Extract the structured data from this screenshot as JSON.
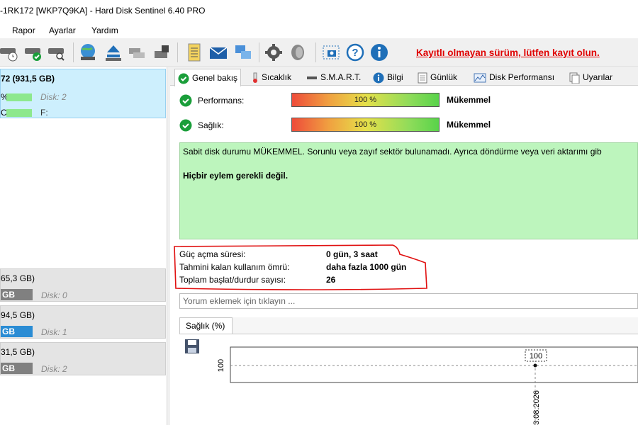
{
  "window": {
    "title": "-1RK172 [WKP7Q9KA]  -  Hard Disk Sentinel 6.40 PRO"
  },
  "menu": {
    "items": [
      "Rapor",
      "Ayarlar",
      "Yardım"
    ]
  },
  "toolbar": {
    "unregistered_notice": "Kayıtlı olmayan sürüm, lütfen kayıt olun."
  },
  "left": {
    "disk": {
      "title": "72  (931,5 GB)",
      "row1_pct": "%",
      "row1_label": "Disk: 2",
      "row2_pct": "C",
      "row2_label": "F:"
    },
    "volumes": [
      {
        "size": "65,3 GB)",
        "gb": "GB",
        "label": "Disk: 0",
        "color": "#808080"
      },
      {
        "size": "94,5 GB)",
        "gb": "GB",
        "label": "Disk: 1",
        "color": "#2a8cd4"
      },
      {
        "size": "31,5 GB)",
        "gb": "GB",
        "label": "Disk: 2",
        "color": "#808080"
      }
    ]
  },
  "tabs": [
    "Genel bakış",
    "Sıcaklık",
    "S.M.A.R.T.",
    "Bilgi",
    "Günlük",
    "Disk Performansı",
    "Uyarılar"
  ],
  "overview": {
    "performance": {
      "label": "Performans:",
      "percent": "100 %",
      "status": "Mükemmel",
      "value": 100
    },
    "health": {
      "label": "Sağlık:",
      "percent": "100 %",
      "status": "Mükemmel",
      "value": 100
    },
    "status_text": "Sabit disk durumu MÜKEMMEL. Sorunlu veya zayıf sektör bulunamadı. Ayrıca döndürme veya veri aktarımı gib",
    "action_text": "Hiçbir eylem gerekli değil.",
    "info": [
      {
        "label": "Güç açma süresi:",
        "value": "0 gün, 3 saat"
      },
      {
        "label": "Tahmini kalan kullanım ömrü:",
        "value": "daha fazla 1000 gün"
      },
      {
        "label": "Toplam başlat/durdur sayısı:",
        "value": "26"
      }
    ],
    "comment_placeholder": "Yorum eklemek için tıklayın ..."
  },
  "chart_data": {
    "type": "line",
    "title": "Sağlık (%)",
    "x": [
      "3.08.2026"
    ],
    "series": [
      {
        "values": [
          100
        ]
      }
    ],
    "ytick": "100",
    "point_label": "100"
  }
}
